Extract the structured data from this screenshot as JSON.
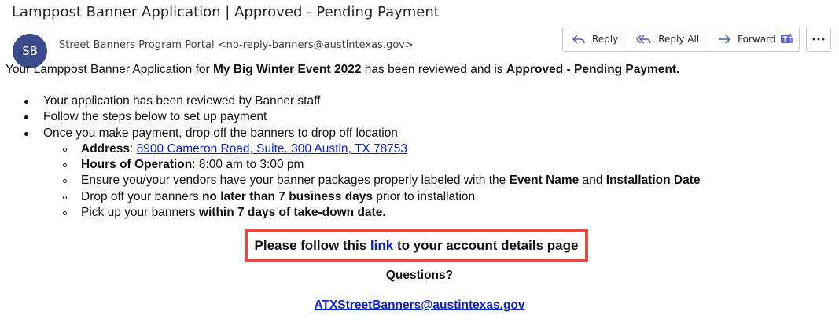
{
  "email": {
    "subject": "Lamppost Banner Application | Approved - Pending Payment",
    "avatar_initials": "SB",
    "sender": "Street Banners Program Portal <no-reply-banners@austintexas.gov>"
  },
  "toolbar": {
    "reply": "Reply",
    "reply_all": "Reply All",
    "forward": "Forward",
    "teams_icon": "teams-icon",
    "more_icon": "more-icon"
  },
  "body": {
    "intro_prefix": "Your Lamppost Banner Application for ",
    "event_name": "My Big Winter Event 2022",
    "intro_middle": " has been reviewed and is ",
    "status": "Approved - Pending Payment.",
    "bullets": [
      "Your application has been reviewed by Banner staff",
      "Follow the steps below to set up payment",
      "Once you make payment, drop off the banners to drop off location"
    ],
    "sub": {
      "address_label": "Address",
      "address_sep": ": ",
      "address_link": "8900 Cameron Road, Suite. 300 Austin, TX 78753",
      "hours_label": "Hours of Operation",
      "hours_value": ": 8:00 am to 3:00 pm",
      "ensure_prefix": "Ensure you/your vendors have your banner packages properly labeled with the ",
      "ensure_event": "Event Name",
      "ensure_and": " and ",
      "ensure_date": "Installation Date",
      "dropoff_prefix": "Drop off your banners ",
      "dropoff_bold": "no later than 7 business days",
      "dropoff_suffix": " prior to installation",
      "pickup_prefix": "Pick up your banners ",
      "pickup_bold": "within 7 days of take-down date."
    },
    "cta_prefix": "Please follow this ",
    "cta_link": "link",
    "cta_suffix": " to your account details page",
    "questions": "Questions?",
    "contact_email": "ATXStreetBanners@austintexas.gov"
  },
  "colors": {
    "link": "#0b1fd4",
    "highlight_border": "#e84545",
    "avatar_bg": "#3b4a8c",
    "teams_purple": "#5b5fc7"
  }
}
